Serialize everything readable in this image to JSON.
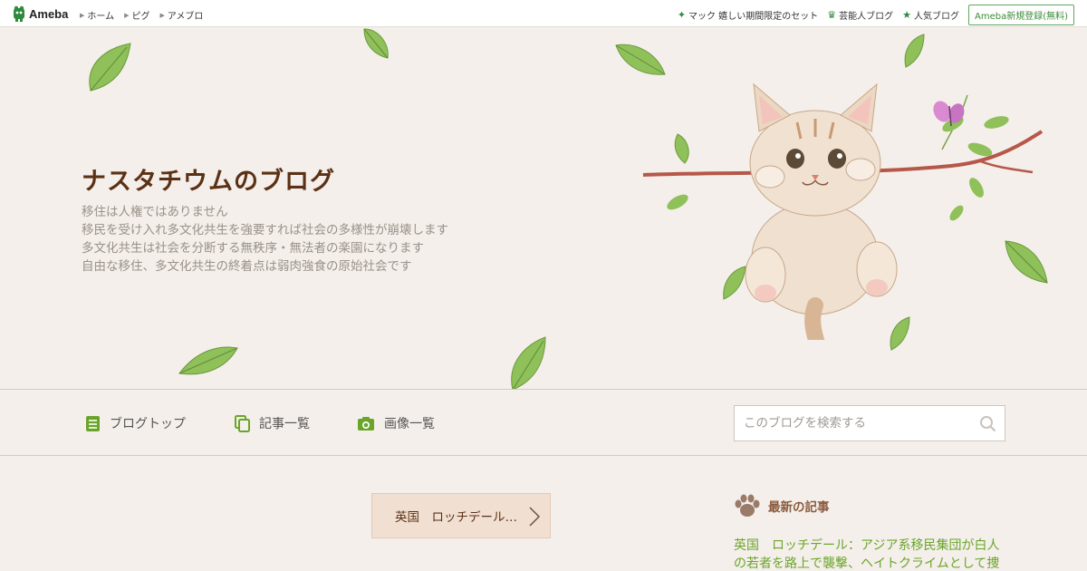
{
  "topbar": {
    "logo_text": "Ameba",
    "nav": [
      "ホーム",
      "ピグ",
      "アメブロ"
    ],
    "right_items": [
      {
        "icon": "sparkle-icon",
        "label": "マック 嬉しい期間限定のセット"
      },
      {
        "icon": "crown-icon",
        "label": "芸能人ブログ"
      },
      {
        "icon": "star-icon",
        "label": "人気ブログ"
      }
    ],
    "register_label": "Ameba新規登録(無料)"
  },
  "header": {
    "title": "ナスタチウムのブログ",
    "description": [
      "移住は人権ではありません",
      "移民を受け入れ多文化共生を強要すれば社会の多様性が崩壊します",
      "多文化共生は社会を分断する無秩序・無法者の楽園になります",
      "自由な移住、多文化共生の終着点は弱肉強食の原始社会です"
    ]
  },
  "nav": {
    "items": [
      {
        "icon": "document-icon",
        "label": "ブログトップ"
      },
      {
        "icon": "pages-icon",
        "label": "記事一覧"
      },
      {
        "icon": "camera-icon",
        "label": "画像一覧"
      }
    ],
    "search_placeholder": "このブログを検索する"
  },
  "content": {
    "post_nav_label": "英国　ロッチデール…"
  },
  "sidebar": {
    "heading": "最新の記事",
    "latest_post": "英国　ロッチデール：アジア系移民集団が白人の若者を路上で襲撃、ヘイトクライムとして捜"
  },
  "colors": {
    "background": "#f4efea",
    "title": "#5b3116",
    "accent_green": "#6aa52a",
    "brand_green": "#2f8a3f"
  }
}
